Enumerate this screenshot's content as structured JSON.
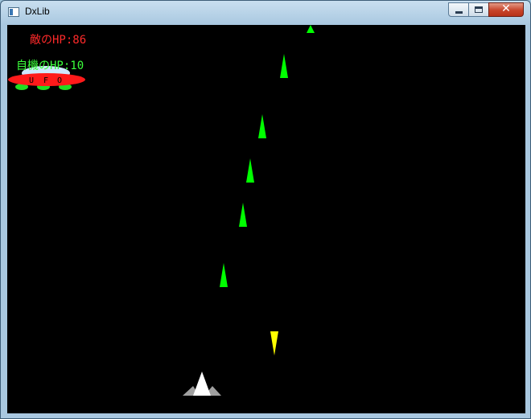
{
  "window": {
    "title": "DxLib",
    "minimize_icon": "minimize-icon",
    "maximize_icon": "maximize-icon",
    "close_icon": "close-icon",
    "close_glyph": "✕"
  },
  "hud": {
    "enemy_hp_text": "敵のHP:86",
    "player_hp_text": "自機のHP:10",
    "enemy_hp": 86,
    "player_hp": 10,
    "enemy_color": "#ff2a2a",
    "player_color": "#3cff3c"
  },
  "ufo": {
    "label_letters": [
      "U",
      "F",
      "O"
    ],
    "body_color": "#ff1a1a",
    "dome_color": "#cfe8ff",
    "light_color": "#22dd22"
  },
  "colors": {
    "background": "#000000",
    "player_bullet": "#00ff00",
    "enemy_bullet": "#ffff00",
    "ship_body": "#ffffff",
    "ship_wings": "#a0a0a0"
  }
}
